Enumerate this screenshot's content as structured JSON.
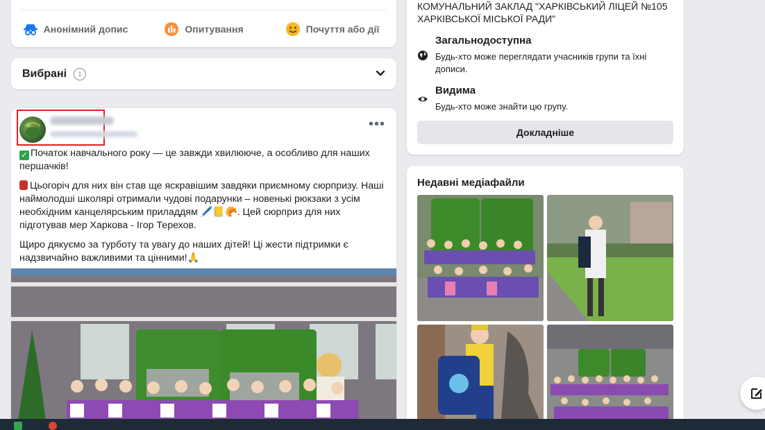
{
  "composer": {
    "actions": [
      {
        "label": "Анонімний допис",
        "icon": "incognito-icon",
        "color": "#1877f2"
      },
      {
        "label": "Опитування",
        "icon": "poll-icon",
        "color": "#f7923b"
      },
      {
        "label": "Почуття або дії",
        "icon": "smiley-icon",
        "color": "#f7b928"
      }
    ]
  },
  "favorites": {
    "title": "Вибрані",
    "info_glyph": "i"
  },
  "post": {
    "more_glyph": "•••",
    "paragraphs": [
      "Початок навчального року — це завжди хвилююче, а особливо для наших першачків!",
      "Цьогоріч для них він став ще яскравішим завдяки приємному сюрпризу. Наші наймолодші школярі отримали чудові подарунки – новенькі рюкзаки з усім необхідним канцелярським приладдям 🖊️📒🥐. Цей сюрприз для них підготував мер Харкова -  Ігор Терехов.",
      "Щиро дякуємо за турботу та увагу до наших дітей! Ці жести підтримки є надзвичайно важливими та цінними!🙏"
    ]
  },
  "about": {
    "org_name": "КОМУНАЛЬНИЙ ЗАКЛАД \"ХАРКІВСЬКИЙ ЛІЦЕЙ №105 ХАРКІВСЬКОЇ МІСЬКОЇ РАДИ\"",
    "public_title": "Загальнодоступна",
    "public_desc": "Будь-хто може переглядати учасників групи та їхні дописи.",
    "visible_title": "Видима",
    "visible_desc": "Будь-хто може знайти цю групу.",
    "more_button": "Докладніше"
  },
  "media": {
    "title": "Недавні медіафайли"
  },
  "colors": {
    "accent": "#1877f2",
    "highlight_box": "#e02020",
    "page_bg": "#e9ebee"
  }
}
